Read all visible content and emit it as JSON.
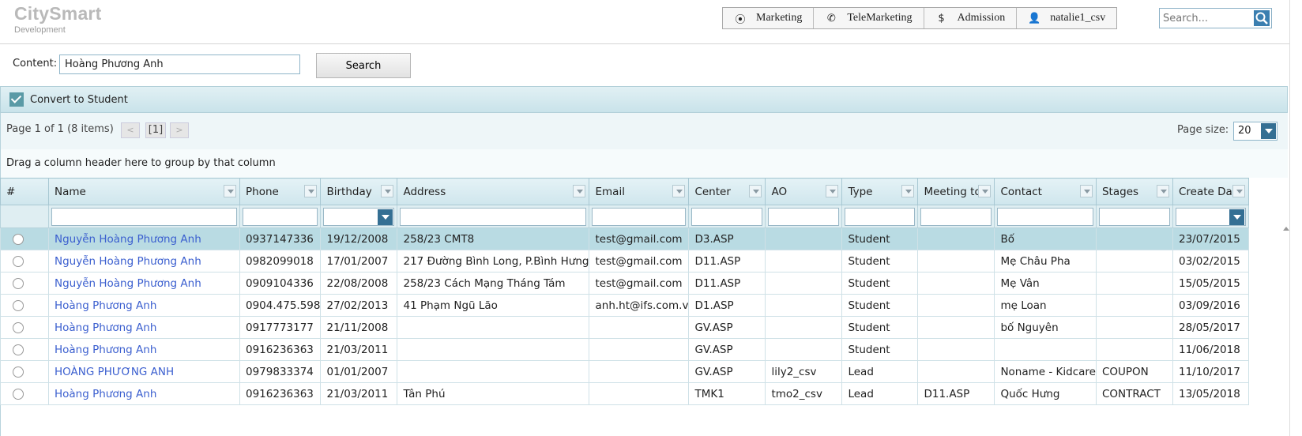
{
  "app": {
    "logo": "CitySmart",
    "logo_sub": "Development"
  },
  "topnav": [
    {
      "icon": "target-icon",
      "glyph": "⦿",
      "label": "Marketing"
    },
    {
      "icon": "phone-icon",
      "glyph": "✆",
      "label": "TeleMarketing"
    },
    {
      "icon": "dollar-icon",
      "glyph": "$",
      "label": "Admission"
    },
    {
      "icon": "user-icon",
      "glyph": "👤",
      "label": "natalie1_csv"
    }
  ],
  "top_search": {
    "placeholder": "Search..."
  },
  "filter": {
    "content_label": "Content:",
    "content_value": "Hoàng Phương Anh",
    "search_label": "Search"
  },
  "toolbar": {
    "convert_label": "Convert to Student"
  },
  "pager": {
    "info": "Page 1 of 1 (8 items)",
    "prev": "<",
    "current": "[1]",
    "next": ">",
    "page_size_label": "Page size:",
    "page_size": "20"
  },
  "groupbar": {
    "text": "Drag a column header here to group by that column"
  },
  "columns": [
    "#",
    "Name",
    "Phone",
    "Birthday",
    "Address",
    "Email",
    "Center",
    "AO",
    "Type",
    "Meeting to",
    "Contact",
    "Stages",
    "Create Date"
  ],
  "rows": [
    [
      "",
      "Nguyễn Hoàng Phương Anh",
      "0937147336",
      "19/12/2008",
      "258/23 CMT8",
      "test@gmail.com",
      "D3.ASP",
      "",
      "Student",
      "",
      "Bố",
      "",
      "23/07/2015"
    ],
    [
      "",
      "Nguyễn Hoàng Phương Anh",
      "0982099018",
      "17/01/2007",
      "217 Đường Bình Long, P.Bình Hưng",
      "test@gmail.com",
      "D11.ASP",
      "",
      "Student",
      "",
      "Mẹ Châu Pha",
      "",
      "03/02/2015"
    ],
    [
      "",
      "Nguyễn Hoàng Phương Anh",
      "0909104336",
      "22/08/2008",
      "258/23 Cách Mạng Tháng Tám",
      "test@gmail.com",
      "D11.ASP",
      "",
      "Student",
      "",
      "Mẹ Vân",
      "",
      "15/05/2015"
    ],
    [
      "",
      "Hoàng Phương Anh",
      "0904.475.598",
      "27/02/2013",
      "41 Phạm Ngũ Lão",
      "anh.ht@ifs.com.v",
      "D1.ASP",
      "",
      "Student",
      "",
      "mẹ Loan",
      "",
      "03/09/2016"
    ],
    [
      "",
      "Hoàng Phương Anh",
      "0917773177",
      "21/11/2008",
      "",
      "",
      "GV.ASP",
      "",
      "Student",
      "",
      "bố Nguyên",
      "",
      "28/05/2017"
    ],
    [
      "",
      "Hoàng Phương Anh",
      "0916236363",
      "21/03/2011",
      "",
      "",
      "GV.ASP",
      "",
      "Student",
      "",
      "",
      "",
      "11/06/2018"
    ],
    [
      "",
      "HOÀNG PHƯƠNG ANH",
      "0979833374",
      "01/01/2007",
      "",
      "",
      "GV.ASP",
      "lily2_csv",
      "Lead",
      "",
      "Noname - Kidcare",
      "COUPON",
      "11/10/2017"
    ],
    [
      "",
      "Hoàng Phương Anh",
      "0916236363",
      "21/03/2011",
      "Tân Phú",
      "",
      "TMK1",
      "tmo2_csv",
      "Lead",
      "D11.ASP",
      "Quốc Hưng",
      "CONTRACT",
      "13/05/2018"
    ]
  ],
  "selected_row": 0
}
